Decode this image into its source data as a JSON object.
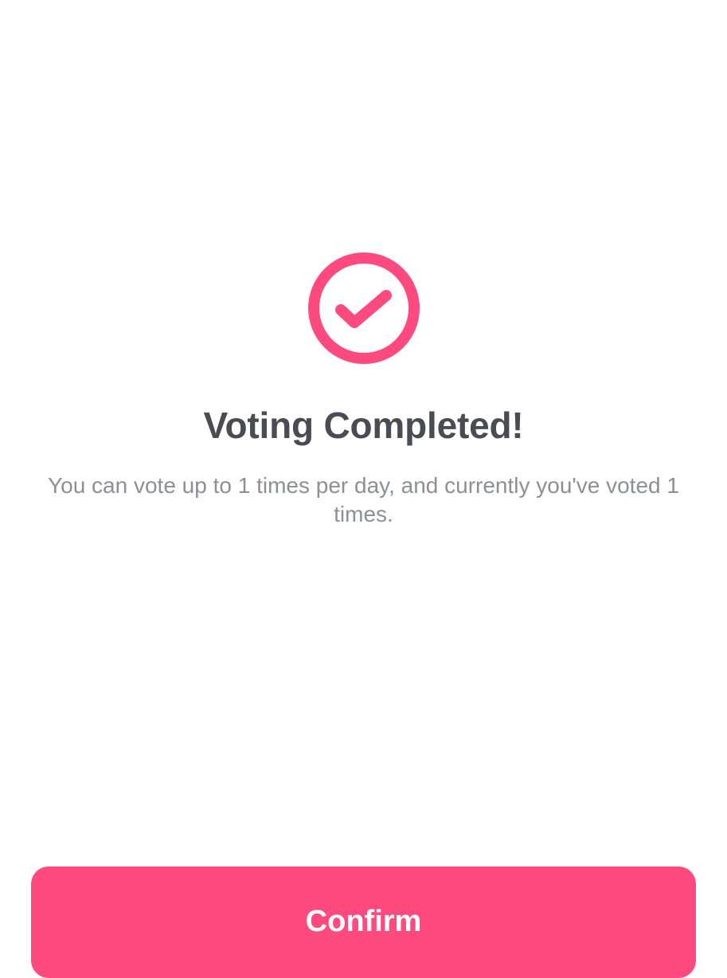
{
  "dialog": {
    "icon": "check-circle-icon",
    "title": "Voting Completed!",
    "message": "You can vote up to 1 times per day, and currently you've voted 1 times.",
    "confirm_label": "Confirm"
  },
  "colors": {
    "accent": "#ff4a80",
    "title_text": "#4a4c54",
    "body_text": "#8b9097",
    "background": "#ffffff"
  }
}
